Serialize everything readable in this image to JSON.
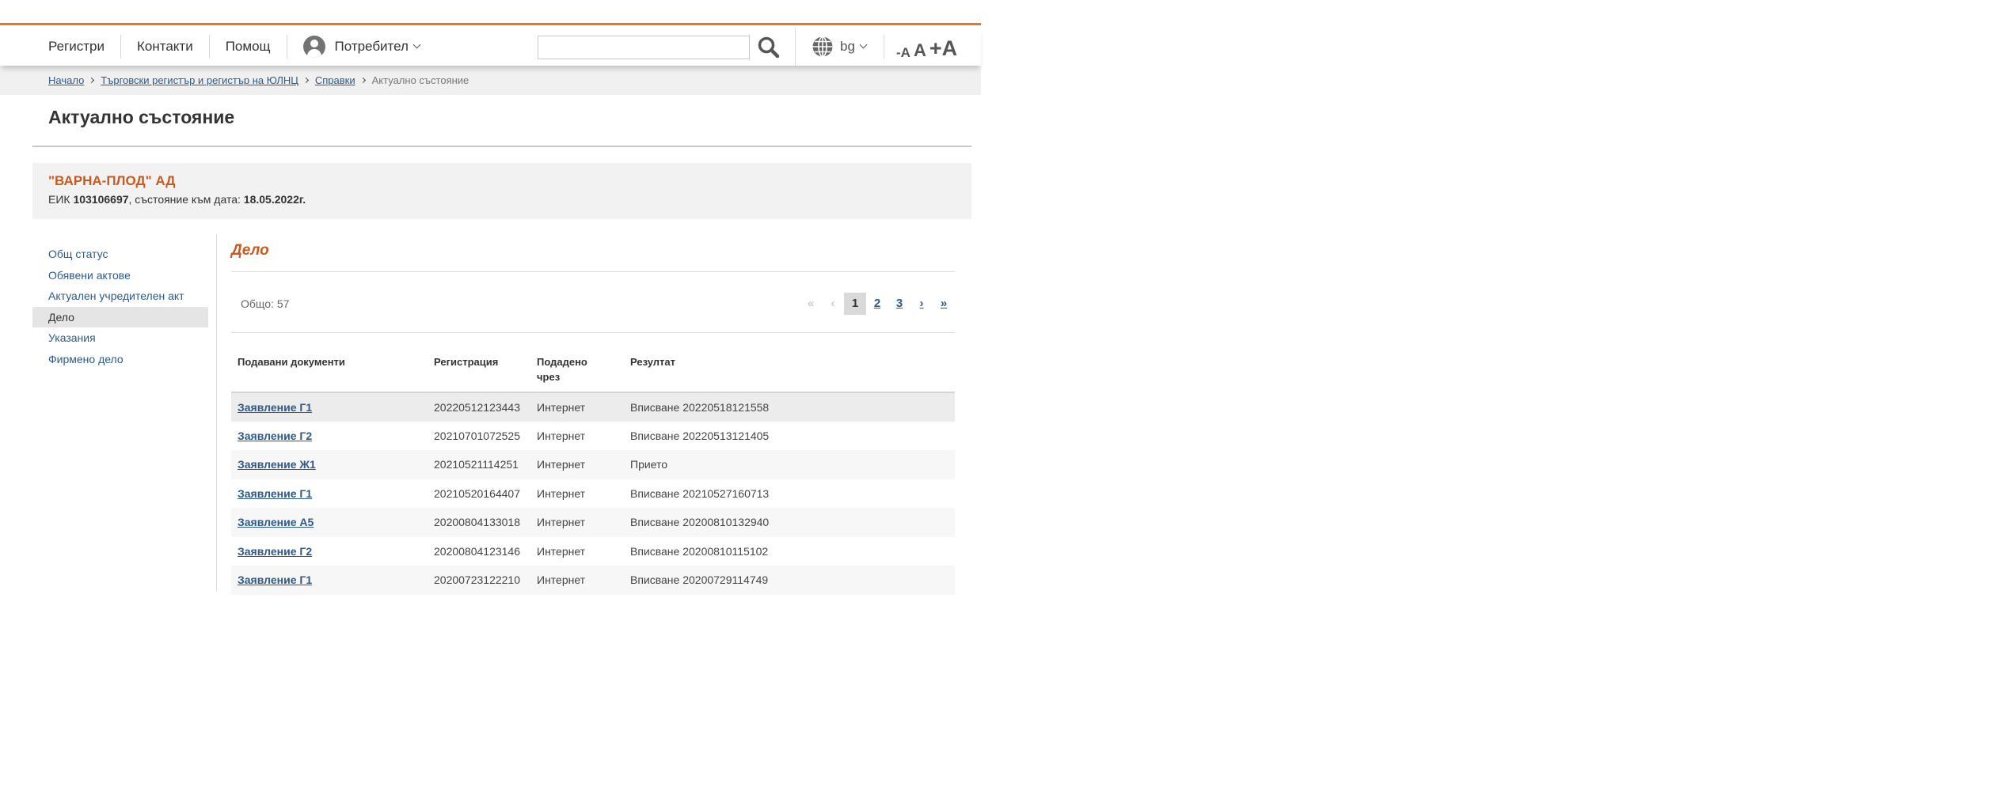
{
  "nav": {
    "items": [
      "Регистри",
      "Контакти",
      "Помощ"
    ],
    "user_label": "Потребител",
    "search_placeholder": "",
    "lang_label": "bg",
    "font_decrease": "-A",
    "font_normal": "A",
    "font_increase": "+A"
  },
  "breadcrumb": {
    "items": [
      "Начало",
      "Търговски регистър и регистър на ЮЛНЦ",
      "Справки"
    ],
    "current": "Актуално състояние"
  },
  "page": {
    "title": "Актуално състояние"
  },
  "company": {
    "name": "\"ВАРНА-ПЛОД\" АД",
    "eik_label": "ЕИК ",
    "eik": "103106697",
    "state_label": ", състояние към дата: ",
    "date": "18.05.2022г."
  },
  "sidebar": {
    "items": [
      {
        "label": "Общ статус"
      },
      {
        "label": "Обявени актове"
      },
      {
        "label": "Актуален учредителен акт"
      },
      {
        "label": "Дело"
      },
      {
        "label": "Указания"
      },
      {
        "label": "Фирмено дело"
      }
    ],
    "active": "Дело"
  },
  "section": {
    "title": "Дело",
    "total": "Общо: 57"
  },
  "pager": {
    "first": "«",
    "prev": "‹",
    "pages": [
      "1",
      "2",
      "3"
    ],
    "current": "1",
    "next": "›",
    "last": "»"
  },
  "table": {
    "headers": {
      "documents": "Подавани документи",
      "registration": "Регистрация",
      "submitted_line1": "Подадено",
      "submitted_line2": "чрез",
      "result": "Резултат"
    },
    "rows": [
      {
        "doc": "Заявление Г1",
        "reg": "20220512123443",
        "via": "Интернет",
        "result": "Вписване 20220518121558"
      },
      {
        "doc": "Заявление Г2",
        "reg": "20210701072525",
        "via": "Интернет",
        "result": "Вписване 20220513121405"
      },
      {
        "doc": "Заявление Ж1",
        "reg": "20210521114251",
        "via": "Интернет",
        "result": "Прието"
      },
      {
        "doc": "Заявление Г1",
        "reg": "20210520164407",
        "via": "Интернет",
        "result": "Вписване 20210527160713"
      },
      {
        "doc": "Заявление А5",
        "reg": "20200804133018",
        "via": "Интернет",
        "result": "Вписване 20200810132940"
      },
      {
        "doc": "Заявление Г2",
        "reg": "20200804123146",
        "via": "Интернет",
        "result": "Вписване 20200810115102"
      },
      {
        "doc": "Заявление Г1",
        "reg": "20200723122210",
        "via": "Интернет",
        "result": "Вписване 20200729114749"
      }
    ]
  },
  "colors": {
    "accent_orange": "#e87722",
    "title_orange": "#c85a1e",
    "link_blue": "#2e5a8a"
  }
}
